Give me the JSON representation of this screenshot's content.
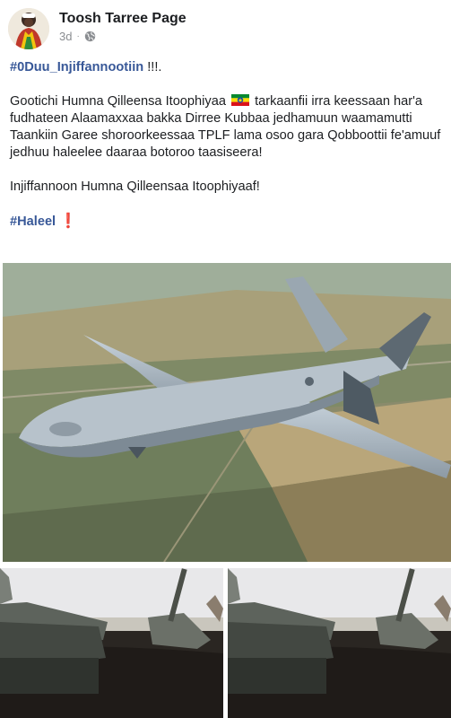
{
  "post": {
    "author": "Toosh Tarree Page",
    "time": "3d",
    "separator": "·",
    "hashtag1": "#0Duu_Injiffannootiin",
    "hashtag1_suffix": "!!!.",
    "body_part1": "Gootichi Humna Qilleensa Itoophiyaa",
    "body_part2": "tarkaanfii irra keessaan har'a fudhateen Alaamaxxaa bakka Dirree Kubbaa jedhamuun waamamutti Taankiin Garee shoroorkeessaa TPLF lama osoo gara Qobboottii fe'amuuf jedhuu haleelee daaraa botoroo taasiseera!",
    "paragraph2": "Injiffannoon Humna Qilleensaa Itoophiyaaf!",
    "hashtag2": "#Haleel",
    "exclaim": "❗"
  },
  "icons": {
    "privacy": "globe-icon",
    "flag": "ethiopia-flag-icon"
  },
  "colors": {
    "hashtag": "#385898",
    "meta": "#8a8d91",
    "text": "#1c1e21",
    "exclaim": "#d7261e"
  },
  "photos": {
    "main": "drone-photo",
    "small": [
      "tank-wreck-photo",
      "tank-wreck-photo"
    ]
  }
}
